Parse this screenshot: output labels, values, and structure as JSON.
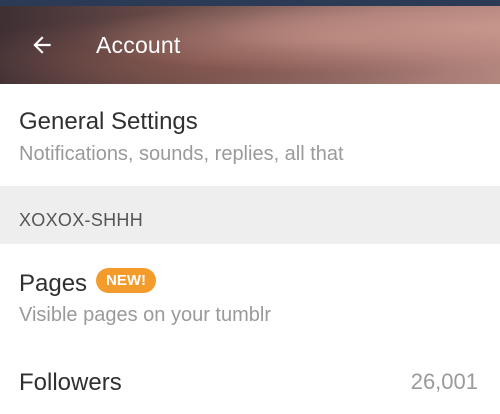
{
  "header": {
    "title": "Account",
    "back_icon": "arrow-left-icon"
  },
  "general_settings": {
    "title": "General Settings",
    "subtitle": "Notifications, sounds, replies, all that"
  },
  "blog_section": {
    "label": "XOXOX-SHHH"
  },
  "pages": {
    "title": "Pages",
    "badge": "NEW!",
    "subtitle": "Visible pages on your tumblr"
  },
  "followers": {
    "title": "Followers",
    "count": "26,001"
  },
  "colors": {
    "badge": "#f39c2b",
    "section_bg": "#eeeeee",
    "primary_text": "#303030",
    "secondary_text": "#9a9a9a"
  }
}
